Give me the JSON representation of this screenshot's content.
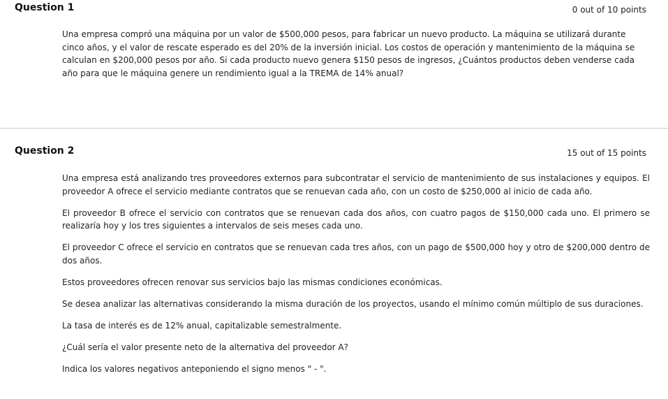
{
  "questions": [
    {
      "title": "Question 1",
      "points": "0 out of 10 points",
      "paragraphs": [
        "Una empresa compró una máquina por un valor de $500,000 pesos, para fabricar un nuevo producto. La máquina se utilizará durante cinco años, y el valor de rescate esperado es del 20% de la inversión inicial. Los costos de operación y mantenimiento de la máquina se calculan en $200,000 pesos por año. Si cada producto nuevo genera $150 pesos de ingresos, ¿Cuántos productos deben venderse cada año para que le máquina genere un rendimiento igual a la TREMA de 14% anual?"
      ]
    },
    {
      "title": "Question 2",
      "points": "15 out of 15 points",
      "paragraphs": [
        "Una empresa está analizando tres proveedores externos para subcontratar el servicio de mantenimiento de sus instalaciones y equipos. El proveedor A ofrece el servicio mediante contratos que se renuevan cada año, con un costo de $250,000 al inicio de cada año.",
        "El proveedor B ofrece el servicio con contratos que se renuevan cada dos años, con cuatro pagos de $150,000 cada uno. El primero se realizaría hoy y los tres siguientes a intervalos de seis meses cada uno.",
        "El proveedor C ofrece el servicio en contratos que se renuevan cada tres años, con un pago de $500,000 hoy y otro de $200,000 dentro de dos años.",
        "Estos proveedores ofrecen renovar sus servicios bajo las mismas condiciones económicas.",
        "Se desea analizar las alternativas considerando la misma duración de los proyectos, usando el mínimo común múltiplo de sus duraciones.",
        "La tasa de interés es de 12% anual, capitalizable semestralmente.",
        "¿Cuál sería el valor presente neto de la alternativa del proveedor A?",
        "Indica los valores negativos anteponiendo el signo menos \" - \"."
      ]
    }
  ]
}
